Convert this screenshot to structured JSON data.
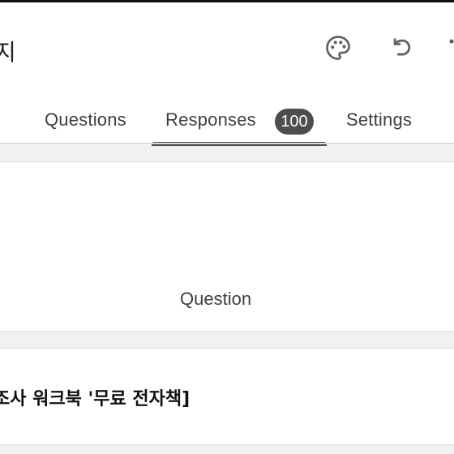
{
  "header": {
    "title": "지",
    "icons": {
      "palette": "palette-icon",
      "undo": "undo-icon",
      "more": "more-vert-icon"
    }
  },
  "tabs": [
    {
      "label": "Questions",
      "active": false
    },
    {
      "label": "Responses",
      "active": true,
      "badge": "100"
    },
    {
      "label": "Settings",
      "active": false
    }
  ],
  "summary": {
    "question_label": "Question"
  },
  "form": {
    "title": "조사 워크북 '무료 전자책]"
  },
  "colors": {
    "active_tab": "#4a4a4a",
    "badge_bg": "#4d4d4d",
    "page_bg": "#f1f1f1"
  }
}
